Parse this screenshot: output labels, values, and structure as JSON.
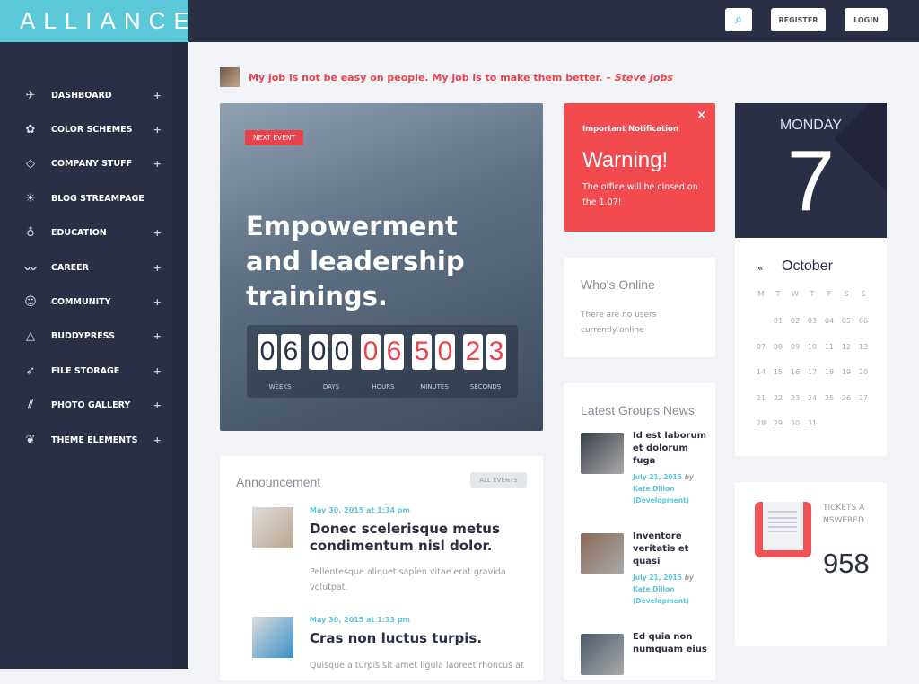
{
  "brand": "ALLIANCE",
  "topbar": {
    "register": "REGISTER",
    "login": "LOGIN",
    "search_icon": "search-icon"
  },
  "sidebar": {
    "items": [
      {
        "label": "DASHBOARD",
        "icon": "telescope-icon",
        "expandable": true
      },
      {
        "label": "COLOR SCHEMES",
        "icon": "flower-icon",
        "expandable": true
      },
      {
        "label": "COMPANY STUFF",
        "icon": "diamond-icon",
        "expandable": true
      },
      {
        "label": "BLOG STREAMPAGE",
        "icon": "fire-icon",
        "expandable": false
      },
      {
        "label": "EDUCATION",
        "icon": "lightbulb-icon",
        "expandable": true
      },
      {
        "label": "CAREER",
        "icon": "mustache-icon",
        "expandable": true
      },
      {
        "label": "COMMUNITY",
        "icon": "chat-icon",
        "expandable": true
      },
      {
        "label": "BUDDYPRESS",
        "icon": "triangle-icon",
        "expandable": true
      },
      {
        "label": "FILE STORAGE",
        "icon": "paper-plane-icon",
        "expandable": true
      },
      {
        "label": "PHOTO GALLERY",
        "icon": "feather-icon",
        "expandable": true
      },
      {
        "label": "THEME ELEMENTS",
        "icon": "bird-icon",
        "expandable": true
      }
    ],
    "plus": "+"
  },
  "quote": {
    "text": "My job is not be easy on people. My job is to make them better. –",
    "author": "Steve Jobs"
  },
  "hero": {
    "badge": "NEXT EVENT",
    "title": "Empowerment and leadership trainings.",
    "countdown": [
      {
        "label": "WEEKS",
        "value": "06"
      },
      {
        "label": "DAYS",
        "value": "00"
      },
      {
        "label": "HOURS",
        "value": "06"
      },
      {
        "label": "MINUTES",
        "value": "50"
      },
      {
        "label": "SECONDS",
        "value": "23"
      }
    ]
  },
  "notification": {
    "header": "Important Notification",
    "title": "Warning!",
    "body": "The office will be closed on the 1.07!",
    "close": "×"
  },
  "who_online": {
    "title": "Who's Online",
    "body": "There are no users currently online"
  },
  "groups": {
    "title": "Latest Groups News",
    "items": [
      {
        "title": "Id est laborum et dolorum fuga",
        "date": "July 21, 2015",
        "by": "by",
        "author": "Kate Dillon (Development)"
      },
      {
        "title": "Inventore veritatis et quasi",
        "date": "July 21, 2015",
        "by": "by",
        "author": "Kate Dillon (Development)"
      },
      {
        "title": "Ed quia non numquam eius",
        "date": "",
        "by": "",
        "author": ""
      }
    ]
  },
  "calendar": {
    "weekday": "MONDAY",
    "day": "7",
    "prev": "«",
    "month": "October",
    "headers": [
      "M",
      "T",
      "W",
      "T",
      "F",
      "S",
      "S"
    ],
    "weeks": [
      [
        "",
        "01",
        "02",
        "03",
        "04",
        "05",
        "06"
      ],
      [
        "07",
        "08",
        "09",
        "10",
        "11",
        "12",
        "13"
      ],
      [
        "14",
        "15",
        "16",
        "17",
        "18",
        "19",
        "20"
      ],
      [
        "21",
        "22",
        "23",
        "24",
        "25",
        "26",
        "27"
      ],
      [
        "28",
        "29",
        "30",
        "31",
        "",
        "",
        ""
      ]
    ]
  },
  "tickets": {
    "label": "TICKETS ANSWERED",
    "value": "958"
  },
  "announcement": {
    "title": "Announcement",
    "button": "ALL EVENTS",
    "items": [
      {
        "date": "May 30, 2015 at 1:34 pm",
        "title": "Donec scelerisque metus condimentum nisl dolor.",
        "body": "Pellentesque aliquet sapien vitae erat gravida volutpat."
      },
      {
        "date": "May 30, 2015 at 1:33 pm",
        "title": "Cras non luctus turpis.",
        "body": "Quisque a turpis sit amet ligula laoreet rhoncus at"
      }
    ]
  },
  "colors": {
    "accent": "#5bc8d8",
    "dark": "#2b2f45",
    "red": "#f14a4f"
  }
}
